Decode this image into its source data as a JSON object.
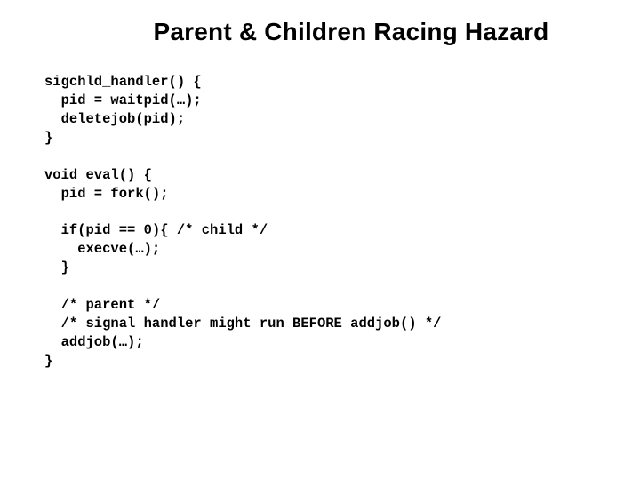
{
  "title": "Parent & Children Racing Hazard",
  "code": "sigchld_handler() {\n  pid = waitpid(…);\n  deletejob(pid);\n}\n\nvoid eval() {\n  pid = fork();\n\n  if(pid == 0){ /* child */\n    execve(…);\n  }\n\n  /* parent */\n  /* signal handler might run BEFORE addjob() */\n  addjob(…);\n}"
}
